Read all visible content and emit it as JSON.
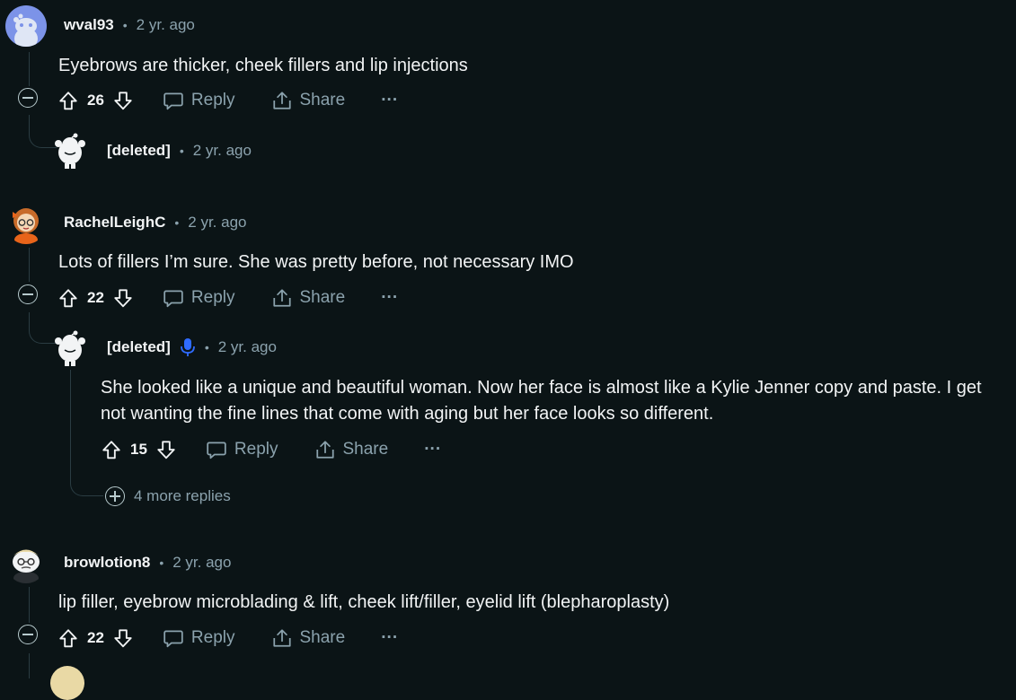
{
  "comments": [
    {
      "username": "wval93",
      "time": "2 yr. ago",
      "text": "Eyebrows are thicker, cheek fillers and lip injections",
      "votes": "26",
      "reply_label": "Reply",
      "share_label": "Share",
      "more_label": "···",
      "replies": [
        {
          "username": "[deleted]",
          "time": "2 yr. ago"
        }
      ]
    },
    {
      "username": "RachelLeighC",
      "time": "2 yr. ago",
      "text": "Lots of fillers I’m sure. She was pretty before, not necessary IMO",
      "votes": "22",
      "reply_label": "Reply",
      "share_label": "Share",
      "more_label": "···",
      "replies": [
        {
          "username": "[deleted]",
          "time": "2 yr. ago",
          "text_line1": "She looked like a unique and beautiful woman. Now her face is almost like a Kylie Jenner copy and paste. I get",
          "text_line2": "not wanting the fine lines that come with aging but her face looks so different.",
          "votes": "15",
          "reply_label": "Reply",
          "share_label": "Share",
          "more_label": "···"
        }
      ],
      "more_replies": "4 more replies"
    },
    {
      "username": "browlotion8",
      "time": "2 yr. ago",
      "text": "lip filler, eyebrow microblading & lift, cheek lift/filler, eyelid lift (blepharoplasty)",
      "votes": "22",
      "reply_label": "Reply",
      "share_label": "Share",
      "more_label": "···"
    }
  ],
  "separator": "•",
  "icons": {
    "upvote": "arrow-up-outline",
    "downvote": "arrow-down-outline",
    "reply": "speech-bubble",
    "share": "share-arrow",
    "collapse": "minus-circle",
    "expand": "plus-circle",
    "voice": "microphone"
  },
  "colors": {
    "background": "#0b1416",
    "mic_accent": "#2f6bff"
  }
}
